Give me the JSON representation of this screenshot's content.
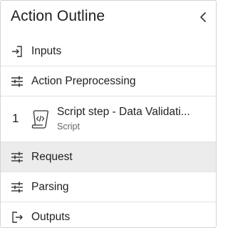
{
  "header": {
    "title": "Action Outline"
  },
  "outline": {
    "inputs": {
      "label": "Inputs",
      "icon": "input-arrow-icon"
    },
    "preprocessing": {
      "label": "Action Preprocessing",
      "icon": "sliders-icon"
    },
    "step": {
      "number": "1",
      "title": "Script step - Data Validati...",
      "type": "Script",
      "icon": "script-icon"
    },
    "request": {
      "label": "Request",
      "icon": "sliders-icon",
      "selected": true
    },
    "parsing": {
      "label": "Parsing",
      "icon": "sliders-icon"
    },
    "outputs": {
      "label": "Outputs",
      "icon": "output-arrow-icon"
    }
  },
  "colors": {
    "selected_bg": "#ececec",
    "divider": "#e3e3e3",
    "text": "#1f1f1f",
    "subtext": "#666666"
  }
}
